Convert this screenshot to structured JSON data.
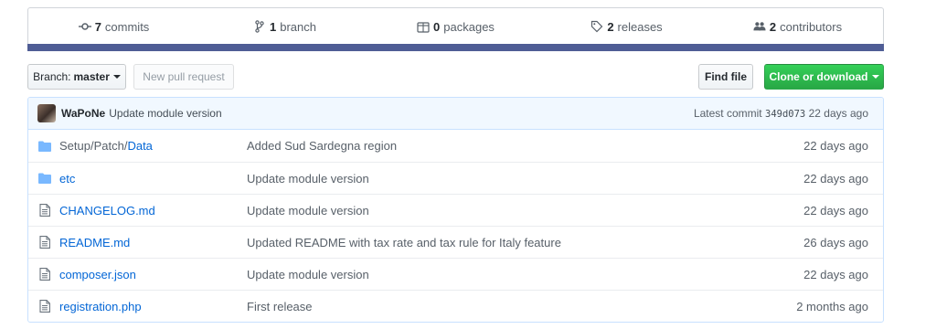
{
  "summary": {
    "commits": {
      "num": "7",
      "label": "commits",
      "icon": "commit-icon"
    },
    "branches": {
      "num": "1",
      "label": "branch",
      "icon": "branch-icon"
    },
    "packages": {
      "num": "0",
      "label": "packages",
      "icon": "package-icon"
    },
    "releases": {
      "num": "2",
      "label": "releases",
      "icon": "tag-icon"
    },
    "contributors": {
      "num": "2",
      "label": "contributors",
      "icon": "people-icon"
    },
    "language_bar_color": "#4f5d95"
  },
  "toolbar": {
    "branch_prefix": "Branch:",
    "branch_name": "master",
    "new_pr_label": "New pull request",
    "find_file_label": "Find file",
    "clone_label": "Clone or download",
    "clone_color": "#28a745"
  },
  "commit": {
    "author": "WaPoNe",
    "message": "Update module version",
    "latest_label": "Latest commit",
    "sha": "349d073",
    "age": "22 days ago"
  },
  "files": [
    {
      "type": "directory",
      "icon": "folder-icon",
      "dir_prefix": "Setup/Patch/",
      "name": "Data",
      "message": "Added Sud Sardegna region",
      "age": "22 days ago"
    },
    {
      "type": "directory",
      "icon": "folder-icon",
      "dir_prefix": "",
      "name": "etc",
      "message": "Update module version",
      "age": "22 days ago"
    },
    {
      "type": "file",
      "icon": "file-icon",
      "dir_prefix": "",
      "name": "CHANGELOG.md",
      "message": "Update module version",
      "age": "22 days ago"
    },
    {
      "type": "file",
      "icon": "file-icon",
      "dir_prefix": "",
      "name": "README.md",
      "message": "Updated README with tax rate and tax rule for Italy feature",
      "age": "26 days ago"
    },
    {
      "type": "file",
      "icon": "file-icon",
      "dir_prefix": "",
      "name": "composer.json",
      "message": "Update module version",
      "age": "22 days ago"
    },
    {
      "type": "file",
      "icon": "file-icon",
      "dir_prefix": "",
      "name": "registration.php",
      "message": "First release",
      "age": "2 months ago"
    }
  ]
}
